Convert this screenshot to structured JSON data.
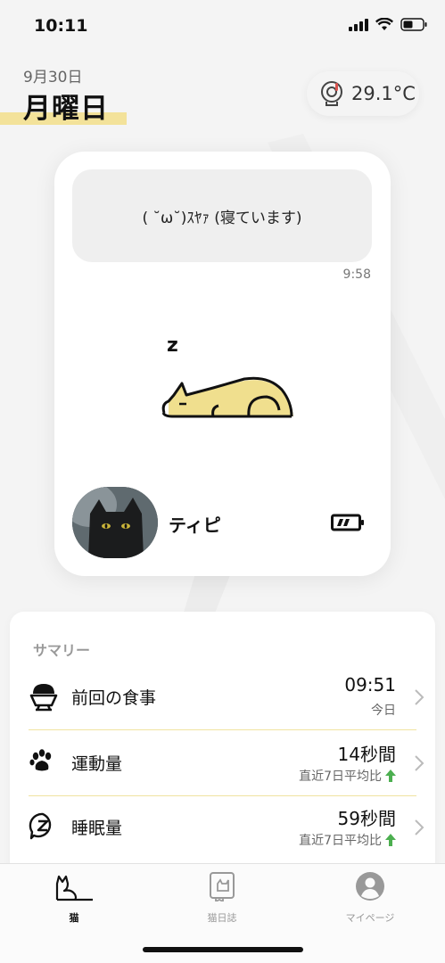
{
  "status_bar": {
    "time": "10:11"
  },
  "header": {
    "date": "9月30日",
    "weekday": "月曜日",
    "temperature": "29.1°C"
  },
  "cat_card": {
    "message": "( ˘ω˘)ｽﾔｧ (寝ています)",
    "message_time": "9:58",
    "sleep_mark": "z",
    "cat_name": "ティピ",
    "colors": {
      "accent": "#f3e29a",
      "cat_fill": "#f0df8e"
    }
  },
  "summary": {
    "title": "サマリー",
    "rows": [
      {
        "label": "前回の食事",
        "value": "09:51",
        "sub": "今日",
        "icon": "food-bowl-icon"
      },
      {
        "label": "運動量",
        "value": "14秒間",
        "sub": "直近7日平均比",
        "trend": "up",
        "icon": "paw-icon"
      },
      {
        "label": "睡眠量",
        "value": "59秒間",
        "sub": "直近7日平均比",
        "trend": "up",
        "icon": "sleep-icon"
      }
    ]
  },
  "tabs": [
    {
      "label": "猫",
      "icon": "cat-icon",
      "active": true
    },
    {
      "label": "猫日誌",
      "icon": "diary-icon",
      "active": false
    },
    {
      "label": "マイページ",
      "icon": "profile-icon",
      "active": false
    }
  ]
}
